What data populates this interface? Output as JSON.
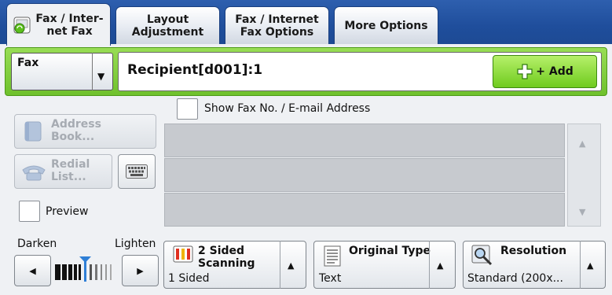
{
  "tabs": [
    {
      "label": "Fax / Inter-\nnet Fax",
      "active": true,
      "icon": "fax-internet-icon"
    },
    {
      "label": "Layout\nAdjustment",
      "active": false
    },
    {
      "label": "Fax / Internet\nFax Options",
      "active": false
    },
    {
      "label": "More Options",
      "active": false
    }
  ],
  "recipient_bar": {
    "mode_select": "Fax",
    "recipient_text": "Recipient[d001]:1",
    "add_label": "+ Add"
  },
  "show_fax_no": {
    "label": "Show Fax No. / E-mail Address",
    "checked": false
  },
  "side_buttons": {
    "address_book": "Address\nBook...",
    "redial_list": "Redial\nList...",
    "keyboard_icon": "keyboard-icon"
  },
  "preview": {
    "label": "Preview",
    "checked": false
  },
  "recipient_list": {
    "rows": [
      "",
      "",
      ""
    ]
  },
  "density": {
    "darken": "Darken",
    "lighten": "Lighten"
  },
  "features": {
    "two_sided": {
      "title": "2 Sided\nScanning",
      "value": "1 Sided"
    },
    "original_type": {
      "title": "Original Type",
      "value": "Text"
    },
    "resolution": {
      "title": "Resolution",
      "value": "Standard (200x..."
    }
  },
  "colors": {
    "tab_bar": "#1f4e9c",
    "recipient_green": "#6fc12c",
    "add_green": "#6fcb1e",
    "panel": "#eff1f4",
    "list_row": "#c7cacf"
  }
}
